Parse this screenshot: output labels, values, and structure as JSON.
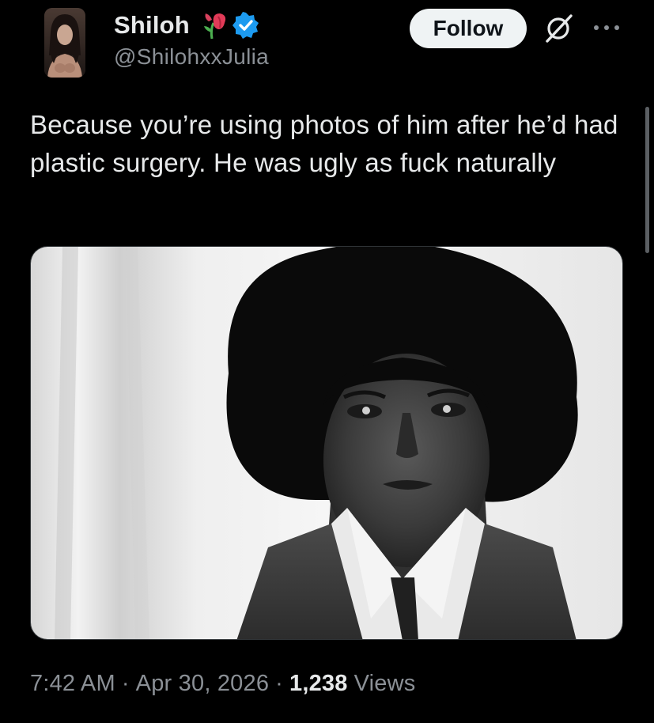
{
  "author": {
    "display_name": "Shiloh",
    "handle": "@ShilohxxJulia",
    "verified": true,
    "name_emoji": "wilted-flower-icon"
  },
  "actions": {
    "follow_label": "Follow",
    "grok_icon": "grok-icon",
    "more_icon": "more-dots-icon"
  },
  "tweet": {
    "text": "Because you’re using photos of him after he’d had plastic surgery. He was ugly as fuck naturally"
  },
  "media": {
    "kind": "black-and-white portrait photo"
  },
  "meta": {
    "time": "7:42 AM",
    "separator": "·",
    "date": "Apr 30, 2026",
    "views_count": "1,238",
    "views_label": "Views"
  },
  "colors": {
    "background": "#000000",
    "primary_text": "#e7e9ea",
    "secondary_text": "#8b9096",
    "follow_bg": "#eff3f4",
    "verified_blue": "#1d9bf0"
  }
}
